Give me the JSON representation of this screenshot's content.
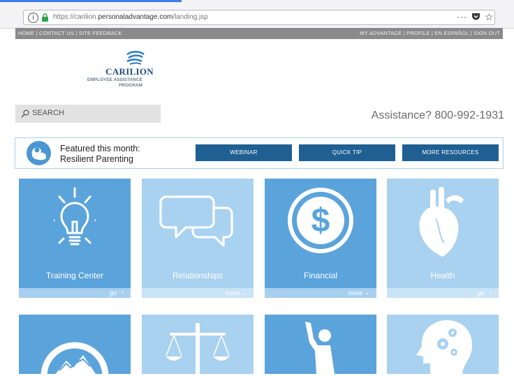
{
  "browser": {
    "url_prefix": "https://carilion.",
    "url_host": "personaladvantage.com",
    "url_path": "/landing.jsp",
    "more_icon": "···",
    "star_icon": "☆",
    "info_icon": "i"
  },
  "nav": {
    "left_links": "HOME | CONTACT US | SITE FEEDBACK",
    "right_links": "MY ADVANTAGE | PROFILE | EN ESPAÑOL | SIGN OUT"
  },
  "logo": {
    "name": "CARILION",
    "line1": "EMPLOYEE ASSISTANCE",
    "line2": "PROGRAM"
  },
  "search": {
    "label": "SEARCH"
  },
  "assistance": "Assistance? 800-992-1931",
  "featured": {
    "line1": "Featured this month:",
    "line2": "Resilient Parenting",
    "buttons": [
      "WEBINAR",
      "QUICK TIP",
      "MORE RESOURCES"
    ]
  },
  "tiles": [
    {
      "label": "Training Center",
      "action": "go",
      "icon": "lightbulb-icon"
    },
    {
      "label": "Relationships",
      "action": "more",
      "icon": "speech-bubbles-icon"
    },
    {
      "label": "Financial",
      "action": "more",
      "icon": "dollar-icon"
    },
    {
      "label": "Health",
      "action": "go",
      "icon": "heart-icon"
    }
  ],
  "bottom_tiles": [
    "mountain-icon",
    "scales-icon",
    "person-cheering-icon",
    "head-gears-icon"
  ],
  "colors": {
    "tile_dark": "#5ba3db",
    "tile_light": "#a9d1f0",
    "button_blue": "#1f5f92",
    "nav_gray": "#8a8a8a"
  }
}
